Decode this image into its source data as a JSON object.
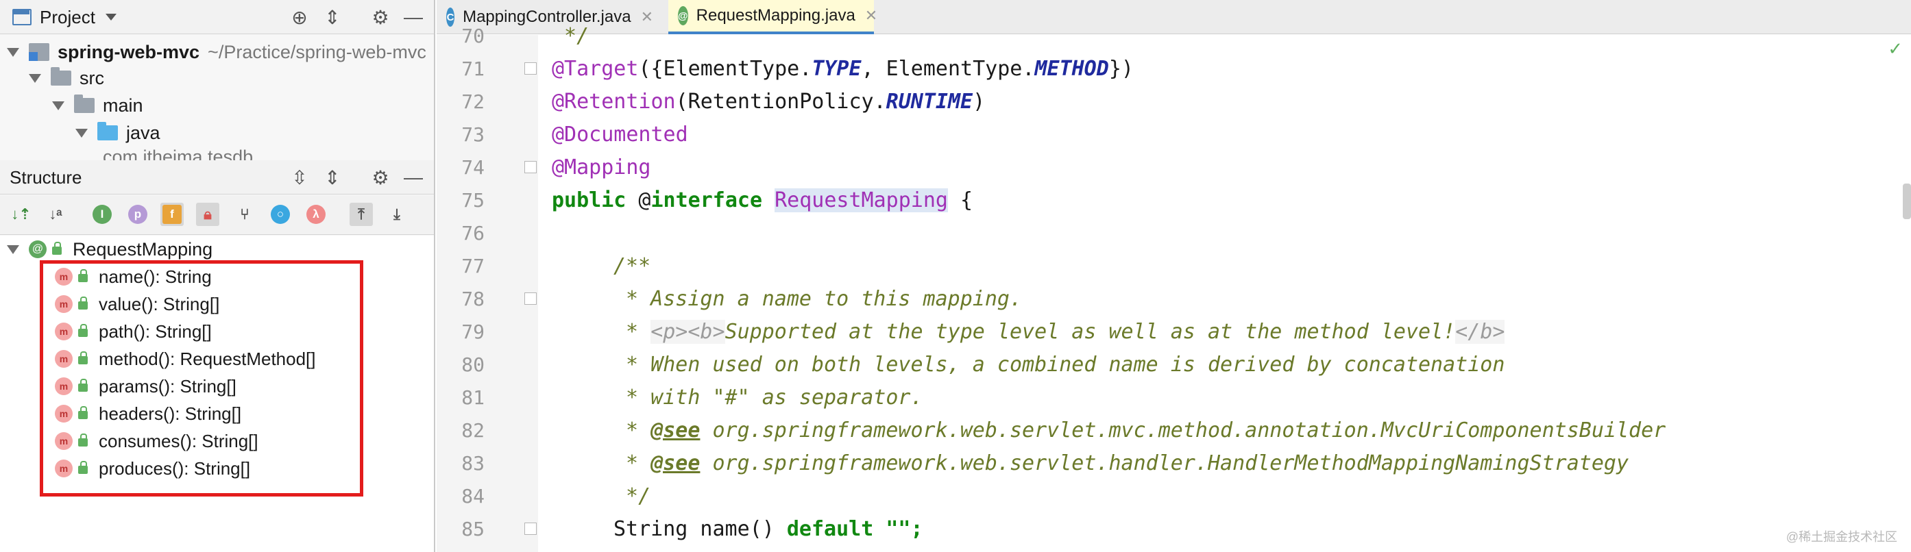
{
  "project_panel": {
    "title": "Project",
    "tree": [
      {
        "label": "spring-web-mvc",
        "path": "~/Practice/spring-web-mvc",
        "level": 0
      },
      {
        "label": "src",
        "level": 1
      },
      {
        "label": "main",
        "level": 2
      },
      {
        "label": "java",
        "level": 3
      },
      {
        "label": "com.itheima.tesdb",
        "level": 4
      }
    ]
  },
  "structure_panel": {
    "title": "Structure",
    "root": "RequestMapping",
    "members": [
      "name(): String",
      "value(): String[]",
      "path(): String[]",
      "method(): RequestMethod[]",
      "params(): String[]",
      "headers(): String[]",
      "consumes(): String[]",
      "produces(): String[]"
    ],
    "member_icon_letter": "m",
    "toolbar_letters": {
      "p": "p",
      "f": "f",
      "lambda": "λ"
    }
  },
  "tabs": [
    {
      "label": "MappingController.java",
      "icon_letter": "C",
      "active": false
    },
    {
      "label": "RequestMapping.java",
      "icon_letter": "@",
      "active": true
    }
  ],
  "editor": {
    "line_numbers": [
      "70",
      "71",
      "72",
      "73",
      "74",
      "75",
      "76",
      "77",
      "78",
      "79",
      "80",
      "81",
      "82",
      "83",
      "84",
      "85"
    ],
    "partial_first_line": " */",
    "line71": {
      "anno": "@Target",
      "open": "({ElementType.",
      "c1": "TYPE",
      "mid": ", ElementType.",
      "c2": "METHOD",
      "close": "})"
    },
    "line72": {
      "anno": "@Retention",
      "open": "(RetentionPolicy.",
      "c1": "RUNTIME",
      "close": ")"
    },
    "line73": "@Documented",
    "line74": "@Mapping",
    "line75": {
      "kw1": "public",
      "at": " @",
      "kw2": "interface",
      "name": "RequestMapping",
      "brace": " {"
    },
    "line77": "/**",
    "line78": " * Assign a name to this mapping.",
    "line79": {
      "star": " * ",
      "tag_p": "<p><b>",
      "text": "Supported at the type level as well as at the method level!",
      "tag_b": "</b>"
    },
    "line80": " * When used on both levels, a combined name is derived by concatenation",
    "line81": " * with \"#\" as separator.",
    "line82": {
      "star": " * ",
      "see": "@see",
      "ref": " org.springframework.web.servlet.mvc.method.annotation.MvcUriComponentsBuilder"
    },
    "line83": {
      "star": " * ",
      "see": "@see",
      "ref": " org.springframework.web.servlet.handler.HandlerMethodMappingNamingStrategy"
    },
    "line84": " */",
    "line85": {
      "type": "String name() ",
      "kw": "default",
      "str": " \"\";"
    }
  },
  "watermark": "@稀土掘金技术社区",
  "colors": {
    "highlight_box": "#e31c1c",
    "active_tab_underline": "#4083c9",
    "current_line": "#fefbe0"
  }
}
